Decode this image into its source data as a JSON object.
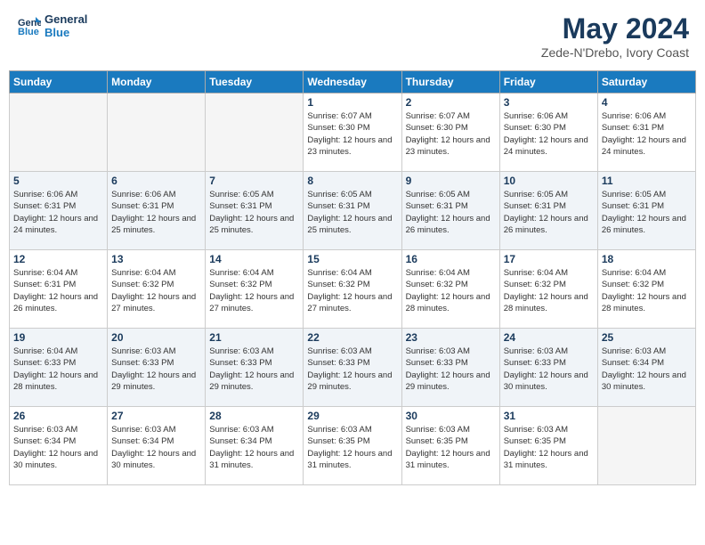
{
  "header": {
    "logo_line1": "General",
    "logo_line2": "Blue",
    "month_title": "May 2024",
    "location": "Zede-N'Drebo, Ivory Coast"
  },
  "weekdays": [
    "Sunday",
    "Monday",
    "Tuesday",
    "Wednesday",
    "Thursday",
    "Friday",
    "Saturday"
  ],
  "weeks": [
    [
      {
        "day": "",
        "sunrise": "",
        "sunset": "",
        "daylight": ""
      },
      {
        "day": "",
        "sunrise": "",
        "sunset": "",
        "daylight": ""
      },
      {
        "day": "",
        "sunrise": "",
        "sunset": "",
        "daylight": ""
      },
      {
        "day": "1",
        "sunrise": "Sunrise: 6:07 AM",
        "sunset": "Sunset: 6:30 PM",
        "daylight": "Daylight: 12 hours and 23 minutes."
      },
      {
        "day": "2",
        "sunrise": "Sunrise: 6:07 AM",
        "sunset": "Sunset: 6:30 PM",
        "daylight": "Daylight: 12 hours and 23 minutes."
      },
      {
        "day": "3",
        "sunrise": "Sunrise: 6:06 AM",
        "sunset": "Sunset: 6:30 PM",
        "daylight": "Daylight: 12 hours and 24 minutes."
      },
      {
        "day": "4",
        "sunrise": "Sunrise: 6:06 AM",
        "sunset": "Sunset: 6:31 PM",
        "daylight": "Daylight: 12 hours and 24 minutes."
      }
    ],
    [
      {
        "day": "5",
        "sunrise": "Sunrise: 6:06 AM",
        "sunset": "Sunset: 6:31 PM",
        "daylight": "Daylight: 12 hours and 24 minutes."
      },
      {
        "day": "6",
        "sunrise": "Sunrise: 6:06 AM",
        "sunset": "Sunset: 6:31 PM",
        "daylight": "Daylight: 12 hours and 25 minutes."
      },
      {
        "day": "7",
        "sunrise": "Sunrise: 6:05 AM",
        "sunset": "Sunset: 6:31 PM",
        "daylight": "Daylight: 12 hours and 25 minutes."
      },
      {
        "day": "8",
        "sunrise": "Sunrise: 6:05 AM",
        "sunset": "Sunset: 6:31 PM",
        "daylight": "Daylight: 12 hours and 25 minutes."
      },
      {
        "day": "9",
        "sunrise": "Sunrise: 6:05 AM",
        "sunset": "Sunset: 6:31 PM",
        "daylight": "Daylight: 12 hours and 26 minutes."
      },
      {
        "day": "10",
        "sunrise": "Sunrise: 6:05 AM",
        "sunset": "Sunset: 6:31 PM",
        "daylight": "Daylight: 12 hours and 26 minutes."
      },
      {
        "day": "11",
        "sunrise": "Sunrise: 6:05 AM",
        "sunset": "Sunset: 6:31 PM",
        "daylight": "Daylight: 12 hours and 26 minutes."
      }
    ],
    [
      {
        "day": "12",
        "sunrise": "Sunrise: 6:04 AM",
        "sunset": "Sunset: 6:31 PM",
        "daylight": "Daylight: 12 hours and 26 minutes."
      },
      {
        "day": "13",
        "sunrise": "Sunrise: 6:04 AM",
        "sunset": "Sunset: 6:32 PM",
        "daylight": "Daylight: 12 hours and 27 minutes."
      },
      {
        "day": "14",
        "sunrise": "Sunrise: 6:04 AM",
        "sunset": "Sunset: 6:32 PM",
        "daylight": "Daylight: 12 hours and 27 minutes."
      },
      {
        "day": "15",
        "sunrise": "Sunrise: 6:04 AM",
        "sunset": "Sunset: 6:32 PM",
        "daylight": "Daylight: 12 hours and 27 minutes."
      },
      {
        "day": "16",
        "sunrise": "Sunrise: 6:04 AM",
        "sunset": "Sunset: 6:32 PM",
        "daylight": "Daylight: 12 hours and 28 minutes."
      },
      {
        "day": "17",
        "sunrise": "Sunrise: 6:04 AM",
        "sunset": "Sunset: 6:32 PM",
        "daylight": "Daylight: 12 hours and 28 minutes."
      },
      {
        "day": "18",
        "sunrise": "Sunrise: 6:04 AM",
        "sunset": "Sunset: 6:32 PM",
        "daylight": "Daylight: 12 hours and 28 minutes."
      }
    ],
    [
      {
        "day": "19",
        "sunrise": "Sunrise: 6:04 AM",
        "sunset": "Sunset: 6:33 PM",
        "daylight": "Daylight: 12 hours and 28 minutes."
      },
      {
        "day": "20",
        "sunrise": "Sunrise: 6:03 AM",
        "sunset": "Sunset: 6:33 PM",
        "daylight": "Daylight: 12 hours and 29 minutes."
      },
      {
        "day": "21",
        "sunrise": "Sunrise: 6:03 AM",
        "sunset": "Sunset: 6:33 PM",
        "daylight": "Daylight: 12 hours and 29 minutes."
      },
      {
        "day": "22",
        "sunrise": "Sunrise: 6:03 AM",
        "sunset": "Sunset: 6:33 PM",
        "daylight": "Daylight: 12 hours and 29 minutes."
      },
      {
        "day": "23",
        "sunrise": "Sunrise: 6:03 AM",
        "sunset": "Sunset: 6:33 PM",
        "daylight": "Daylight: 12 hours and 29 minutes."
      },
      {
        "day": "24",
        "sunrise": "Sunrise: 6:03 AM",
        "sunset": "Sunset: 6:33 PM",
        "daylight": "Daylight: 12 hours and 30 minutes."
      },
      {
        "day": "25",
        "sunrise": "Sunrise: 6:03 AM",
        "sunset": "Sunset: 6:34 PM",
        "daylight": "Daylight: 12 hours and 30 minutes."
      }
    ],
    [
      {
        "day": "26",
        "sunrise": "Sunrise: 6:03 AM",
        "sunset": "Sunset: 6:34 PM",
        "daylight": "Daylight: 12 hours and 30 minutes."
      },
      {
        "day": "27",
        "sunrise": "Sunrise: 6:03 AM",
        "sunset": "Sunset: 6:34 PM",
        "daylight": "Daylight: 12 hours and 30 minutes."
      },
      {
        "day": "28",
        "sunrise": "Sunrise: 6:03 AM",
        "sunset": "Sunset: 6:34 PM",
        "daylight": "Daylight: 12 hours and 31 minutes."
      },
      {
        "day": "29",
        "sunrise": "Sunrise: 6:03 AM",
        "sunset": "Sunset: 6:35 PM",
        "daylight": "Daylight: 12 hours and 31 minutes."
      },
      {
        "day": "30",
        "sunrise": "Sunrise: 6:03 AM",
        "sunset": "Sunset: 6:35 PM",
        "daylight": "Daylight: 12 hours and 31 minutes."
      },
      {
        "day": "31",
        "sunrise": "Sunrise: 6:03 AM",
        "sunset": "Sunset: 6:35 PM",
        "daylight": "Daylight: 12 hours and 31 minutes."
      },
      {
        "day": "",
        "sunrise": "",
        "sunset": "",
        "daylight": ""
      }
    ]
  ]
}
